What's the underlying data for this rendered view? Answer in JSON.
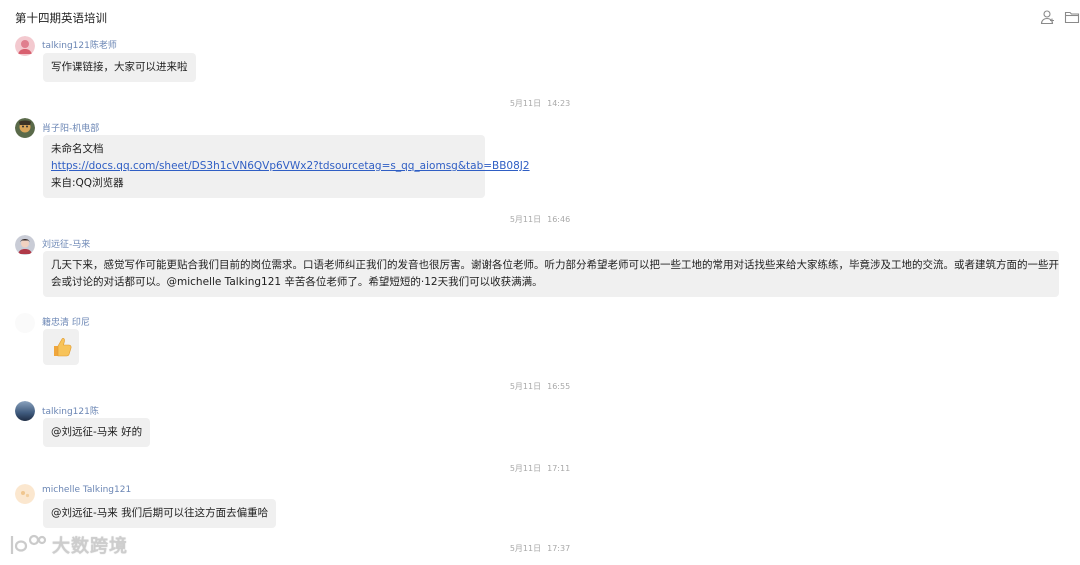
{
  "chat": {
    "title": "第十四期英语培训"
  },
  "header_icons": [
    "person-add-icon",
    "folder-icon"
  ],
  "messages": [
    {
      "sender": "talking121陈老师",
      "lines": [
        "写作课链接，大家可以进来啦"
      ]
    },
    {
      "timestamp_date": "5月11日",
      "timestamp_time": "14:23"
    },
    {
      "sender": "肖子阳-机电部",
      "doc_name": "未命名文档",
      "link": "https://docs.qq.com/sheet/DS3h1cVN6QVp6VWx2?tdsourcetag=s_qq_aiomsg&tab=BB08J2",
      "from": "来自:QQ浏览器"
    },
    {
      "timestamp_date": "5月11日",
      "timestamp_time": "16:46"
    },
    {
      "sender": "刘远征-马来",
      "lines": [
        "几天下来，感觉写作可能更贴合我们目前的岗位需求。口语老师纠正我们的发音也很厉害。谢谢各位老师。听力部分希望老师可以把一些工地的常用对话找些来给大家练练，毕竟涉及工地的交流。或者建筑方面的一些开",
        "会或讨论的对话都可以。@michelle Talking121 辛苦各位老师了。希望短短的·12天我们可以收获满满。"
      ]
    },
    {
      "sender": "籍忠清 印尼",
      "emoji": "👍"
    },
    {
      "timestamp_date": "5月11日",
      "timestamp_time": "16:55"
    },
    {
      "sender": "talking121陈",
      "lines": [
        "@刘远征-马来 好的"
      ]
    },
    {
      "timestamp_date": "5月11日",
      "timestamp_time": "17:11"
    },
    {
      "sender": "michelle Talking121",
      "lines": [
        "@刘远征-马来 我们后期可以往这方面去偏重哈"
      ]
    },
    {
      "timestamp_date": "5月11日",
      "timestamp_time": "17:37"
    }
  ],
  "watermark": {
    "text": "大数跨境"
  },
  "colors": {
    "sender_name": "#6b86b4",
    "bubble_bg": "#f0f0f0",
    "link": "#2f5ec4",
    "timestamp": "#a9a9a9"
  }
}
